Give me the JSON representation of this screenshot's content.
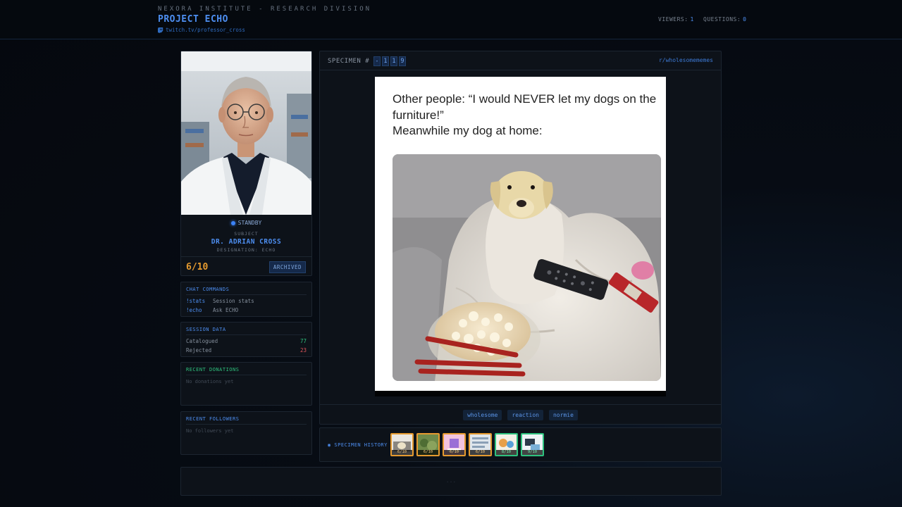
{
  "header": {
    "org": "NEXORA INSTITUTE - RESEARCH DIVISION",
    "project": "PROJECT ECHO",
    "channel": "twitch.tv/professor_cross",
    "viewers_label": "VIEWERS:",
    "viewers": "1",
    "questions_label": "QUESTIONS:",
    "questions": "0"
  },
  "subject": {
    "status": "STANDBY",
    "label": "SUBJECT",
    "name": "DR. ADRIAN CROSS",
    "designation": "DESIGNATION: ECHO",
    "score": "6/10",
    "badge": "ARCHIVED"
  },
  "commands": {
    "title": "CHAT COMMANDS",
    "items": [
      {
        "key": "!stats",
        "desc": "Session stats"
      },
      {
        "key": "!echo",
        "desc": "Ask ECHO"
      }
    ]
  },
  "session": {
    "title": "SESSION DATA",
    "catalogued_label": "Catalogued",
    "catalogued": "77",
    "rejected_label": "Rejected",
    "rejected": "23"
  },
  "donations": {
    "title": "RECENT DONATIONS",
    "empty": "No donations yet"
  },
  "followers": {
    "title": "RECENT FOLLOWERS",
    "empty": "No followers yet"
  },
  "specimen": {
    "label": "SPECIMEN #",
    "digits": [
      "-",
      "1",
      "1",
      "9"
    ],
    "subreddit": "r/wholesomememes",
    "caption": [
      "Other people: “I would NEVER let my dogs on the",
      "furniture!”",
      "Meanwhile my dog at home:"
    ],
    "tags": [
      "wholesome",
      "reaction",
      "normie"
    ]
  },
  "history": {
    "label": "◉ SPECIMEN HISTORY",
    "items": [
      {
        "score": "6/10",
        "status": "amber"
      },
      {
        "score": "6/10",
        "status": "amber"
      },
      {
        "score": "6/10",
        "status": "amber"
      },
      {
        "score": "6/10",
        "status": "amber"
      },
      {
        "score": "8/10",
        "status": "green"
      },
      {
        "score": "9/10",
        "status": "green"
      }
    ]
  },
  "footer": {
    "placeholder": "..."
  },
  "colors": {
    "accent": "#4d8ef0",
    "amber": "#e59a2f",
    "green": "#2ec27e",
    "red": "#e0565b"
  }
}
